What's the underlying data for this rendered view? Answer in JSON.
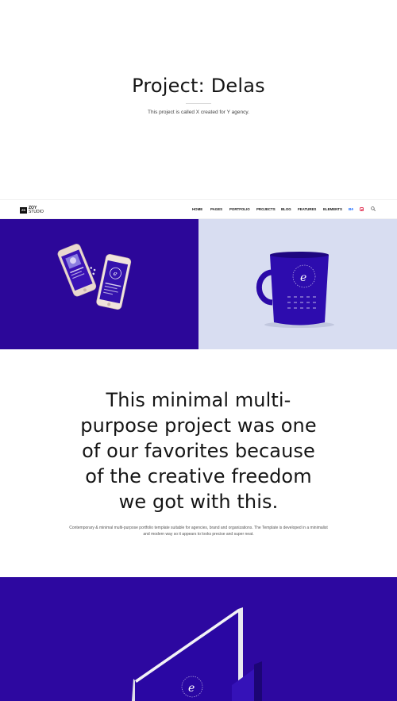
{
  "hero": {
    "title": "Project: Delas",
    "subtitle": "This project is called X created for Y agency."
  },
  "navbar": {
    "logo_line1": "ZOY",
    "logo_line2": "STUDIO",
    "logo_mark": "ZS",
    "menu": [
      "HOME",
      "PAGES",
      "PORTFOLIO",
      "PROJECTS",
      "BLOG",
      "FEATURES",
      "ELEMENTS"
    ],
    "social_behance": "Bē",
    "icons": [
      "behance-icon",
      "instagram-icon",
      "search-icon"
    ]
  },
  "gallery": {
    "left_bg": "#2c0799",
    "right_bg": "#d8ddf1",
    "left_image": "phones-mockup",
    "right_image": "mug-mockup"
  },
  "statement": {
    "lines": [
      "This minimal multi-",
      "purpose project was one",
      "of our favorites because",
      "of the creative freedom",
      "we got with this."
    ]
  },
  "description": "Contemporary & minimal multi-purpose portfolio template suitable for agencies, brand and organizations. The Template is developed in a minimalist and modern way so it appears to looks precise and super neat.",
  "bottom_banner": {
    "bg": "#2d08a0",
    "image": "laptop-mockup"
  }
}
